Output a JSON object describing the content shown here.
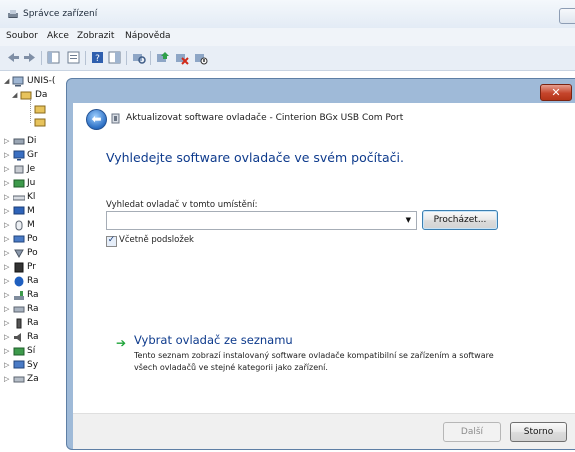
{
  "window": {
    "title": "Správce zařízení"
  },
  "menubar": {
    "items": [
      "Soubor",
      "Akce",
      "Zobrazit",
      "Nápověda"
    ]
  },
  "tree": {
    "items": [
      {
        "label": "UNIS-(",
        "icon": "computer-icon"
      },
      {
        "label": "Di",
        "icon": "disk-icon"
      },
      {
        "label": "Gr",
        "icon": "display-icon"
      },
      {
        "label": "Je",
        "icon": "ide-icon"
      },
      {
        "label": "Ju",
        "icon": "port-icon"
      },
      {
        "label": "Kl",
        "icon": "keyboard-icon"
      },
      {
        "label": "M",
        "icon": "monitor-icon"
      },
      {
        "label": "M",
        "icon": "mouse-icon"
      },
      {
        "label": "Po",
        "icon": "network-icon"
      },
      {
        "label": "Po",
        "icon": "usb-icon"
      },
      {
        "label": "Pr",
        "icon": "processor-icon"
      },
      {
        "label": "Ra",
        "icon": "bluetooth-icon"
      },
      {
        "label": "Ra",
        "icon": "storage-icon"
      },
      {
        "label": "Ra",
        "icon": "controller-icon"
      },
      {
        "label": "Ra",
        "icon": "battery-icon"
      },
      {
        "label": "Ra",
        "icon": "audio-icon"
      },
      {
        "label": "Sí",
        "icon": "network-adapter-icon"
      },
      {
        "label": "Sy",
        "icon": "system-icon"
      },
      {
        "label": "Za",
        "icon": "device-icon"
      }
    ],
    "child_label": "Da"
  },
  "dialog": {
    "title": "Aktualizovat software ovladače - Cinterion BGx USB Com Port",
    "close_label": "✕",
    "heading": "Vyhledejte software ovladače ve svém počítači.",
    "search_label": "Vyhledat ovladač v tomto umístění:",
    "search_value": "",
    "browse_label": "Procházet...",
    "include_subfolders_label": "Včetně podsložek",
    "include_subfolders_checked": true,
    "pick_title": "Vybrat ovladač ze seznamu",
    "pick_description": "Tento seznam zobrazí instalovaný software ovladače kompatibilní se zařízením a software všech ovladačů ve stejné kategorii jako zařízení.",
    "next_label": "Další",
    "cancel_label": "Storno"
  },
  "colors": {
    "heading": "#0d3a8c",
    "accent_green": "#1fa53a",
    "dialog_frame": "#9fbad8"
  }
}
